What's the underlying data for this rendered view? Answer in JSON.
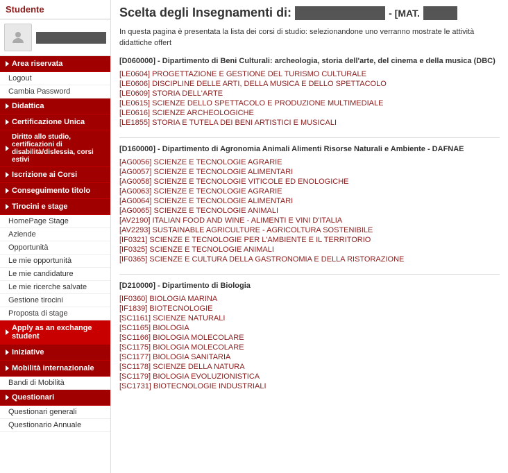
{
  "sidebar": {
    "title": "Studente",
    "username": "",
    "nav_items": [
      {
        "id": "area-riservata",
        "label": "Area riservata",
        "has_arrow": true,
        "sub_items": [
          "Logout",
          "Cambia Password"
        ]
      },
      {
        "id": "didattica",
        "label": "Didattica",
        "has_arrow": true,
        "sub_items": []
      },
      {
        "id": "certificazione-unica",
        "label": "Certificazione Unica",
        "has_arrow": true,
        "sub_items": []
      },
      {
        "id": "diritto-studio",
        "label": "Diritto allo studio, certificazioni di disabilità/dislessia, corsi estivi",
        "has_arrow": true,
        "sub_items": []
      },
      {
        "id": "iscrizione-corsi",
        "label": "Iscrizione ai Corsi",
        "has_arrow": true,
        "sub_items": []
      },
      {
        "id": "conseguimento-titolo",
        "label": "Conseguimento titolo",
        "has_arrow": true,
        "sub_items": []
      },
      {
        "id": "tirocini-stage",
        "label": "Tirocini e stage",
        "has_arrow": true,
        "sub_items": [
          "HomePage Stage",
          "Aziende",
          "Opportunità",
          "Le mie opportunità",
          "Le mie candidature",
          "Le mie ricerche salvate",
          "Gestione tirocini",
          "Proposta di stage"
        ]
      },
      {
        "id": "apply-exchange",
        "label": "Apply as an exchange student",
        "has_arrow": true,
        "sub_items": []
      },
      {
        "id": "iniziative",
        "label": "Iniziative",
        "has_arrow": true,
        "sub_items": []
      },
      {
        "id": "mobilita-internazionale",
        "label": "Mobilità internazionale",
        "has_arrow": true,
        "sub_items": [
          "Bandi di Mobilità"
        ]
      },
      {
        "id": "questionari",
        "label": "Questionari",
        "has_arrow": true,
        "sub_items": [
          "Questionari generali",
          "Questionario Annuale"
        ]
      }
    ]
  },
  "main": {
    "title_prefix": "Scelta degli Insegnamenti di:",
    "student_name_placeholder": "",
    "mat_label": "- [MAT.",
    "mat_value": "",
    "description": "In questa pagina è presentata la lista dei corsi di studio: selezionandone uno verranno mostrate le attività didattiche offert",
    "departments": [
      {
        "id": "D060000",
        "header": "[D060000] - Dipartimento di Beni Culturali: archeologia, storia dell'arte, del cinema e della musica (DBC)",
        "courses": [
          "[LE0604] PROGETTAZIONE E GESTIONE DEL TURISMO CULTURALE",
          "[LE0606] DISCIPLINE DELLE ARTI, DELLA MUSICA E DELLO SPETTACOLO",
          "[LE0609] STORIA DELL'ARTE",
          "[LE0615] SCIENZE DELLO SPETTACOLO E PRODUZIONE MULTIMEDIALE",
          "[LE0616] SCIENZE ARCHEOLOGICHE",
          "[LE1855] STORIA E TUTELA DEI BENI ARTISTICI E MUSICALI"
        ]
      },
      {
        "id": "D160000",
        "header": "[D160000] - Dipartimento di Agronomia Animali Alimenti Risorse Naturali e Ambiente - DAFNAE",
        "courses": [
          "[AG0056] SCIENZE E TECNOLOGIE AGRARIE",
          "[AG0057] SCIENZE E TECNOLOGIE ALIMENTARI",
          "[AG0058] SCIENZE E TECNOLOGIE VITICOLE ED ENOLOGICHE",
          "[AG0063] SCIENZE E TECNOLOGIE AGRARIE",
          "[AG0064] SCIENZE E TECNOLOGIE ALIMENTARI",
          "[AG0065] SCIENZE E TECNOLOGIE ANIMALI",
          "[AV2190] ITALIAN FOOD AND WINE - ALIMENTI E VINI D'ITALIA",
          "[AV2293] SUSTAINABLE AGRICULTURE - AGRICOLTURA SOSTENIBILE",
          "[IF0321] SCIENZE E TECNOLOGIE PER L'AMBIENTE E IL TERRITORIO",
          "[IF0325] SCIENZE E TECNOLOGIE ANIMALI",
          "[IF0365] SCIENZE E CULTURA DELLA GASTRONOMIA E DELLA RISTORAZIONE"
        ]
      },
      {
        "id": "D210000",
        "header": "[D210000] - Dipartimento di Biologia",
        "courses": [
          "[IF0360] BIOLOGIA MARINA",
          "[IF1839] BIOTECNOLOGIE",
          "[SC1161] SCIENZE NATURALI",
          "[SC1165] BIOLOGIA",
          "[SC1166] BIOLOGIA MOLECOLARE",
          "[SC1175] BIOLOGIA MOLECOLARE",
          "[SC1177] BIOLOGIA SANITARIA",
          "[SC1178] SCIENZE DELLA NATURA",
          "[SC1179] BIOLOGIA EVOLUZIONISTICA",
          "[SC1731] BIOTECNOLOGIE INDUSTRIALI"
        ]
      }
    ]
  }
}
